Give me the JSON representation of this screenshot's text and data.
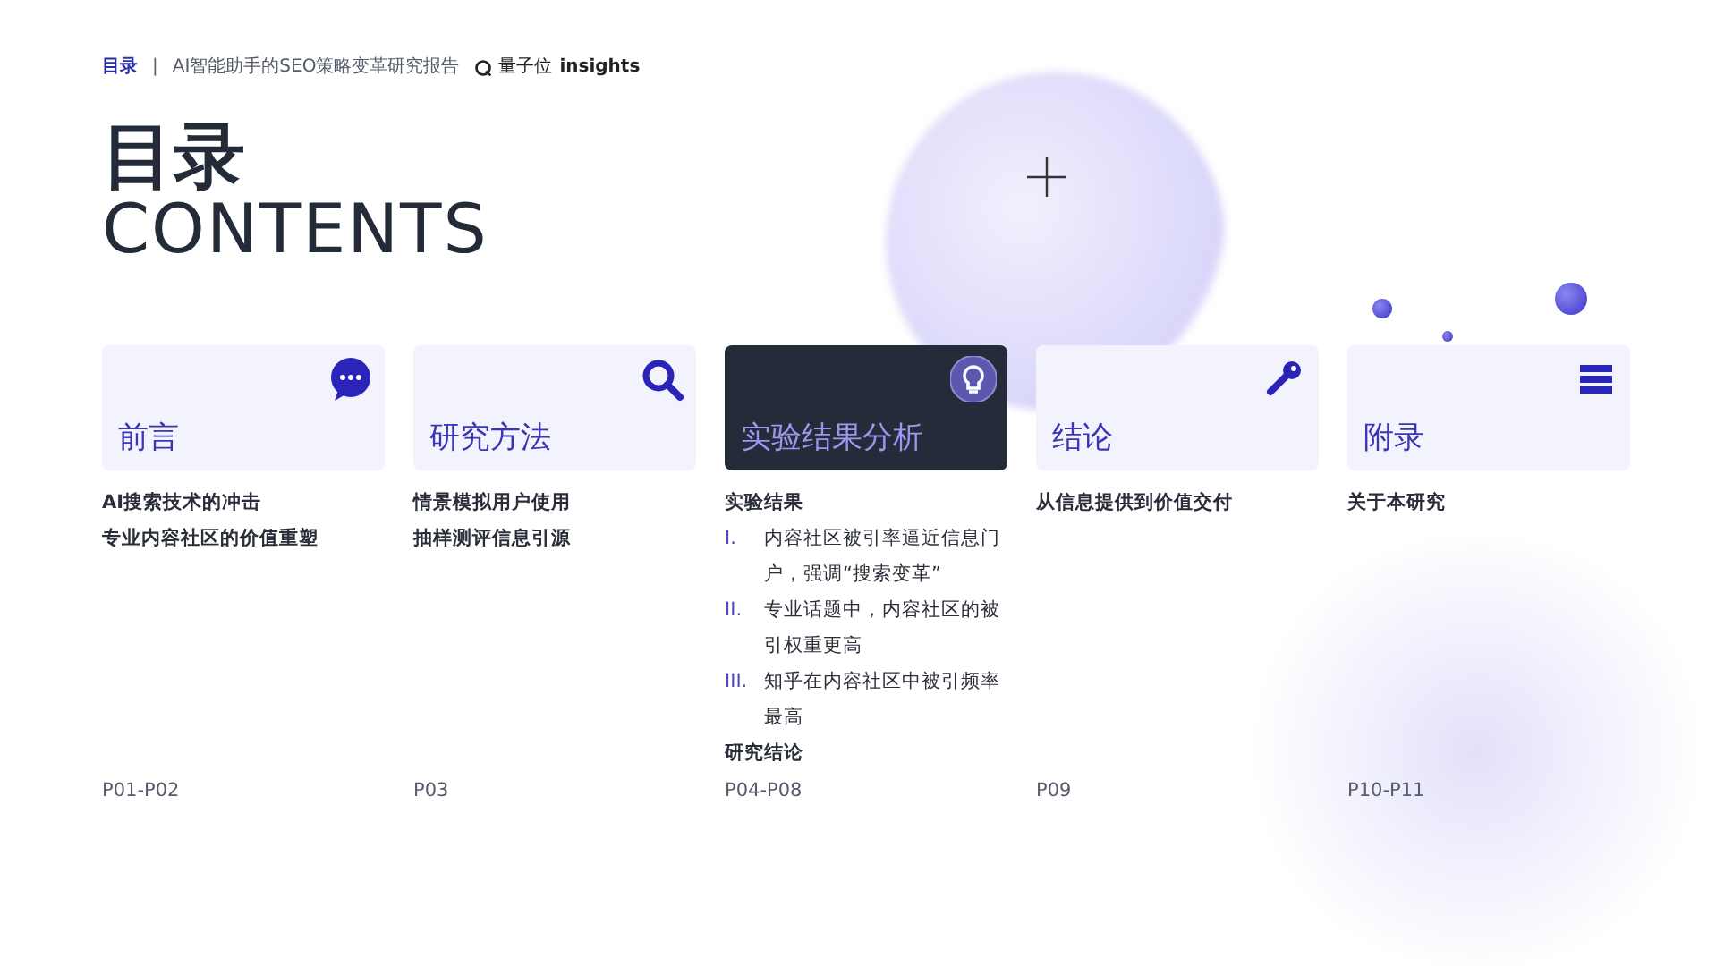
{
  "header": {
    "section": "目录",
    "separator": "|",
    "report_title": "AI智能助手的SEO策略变革研究报告",
    "logo_text": "量子位",
    "logo_suffix": "insights"
  },
  "title": {
    "main": "目录",
    "sub": "CONTENTS"
  },
  "sections": [
    {
      "title": "前言",
      "kind": "chat",
      "selected": false,
      "items": [
        {
          "kind": "heading",
          "text": "AI搜索技术的冲击"
        },
        {
          "kind": "heading",
          "text": "专业内容社区的价值重塑"
        }
      ],
      "pages": "P01-P02"
    },
    {
      "title": "研究方法",
      "kind": "search",
      "selected": false,
      "items": [
        {
          "kind": "heading",
          "text": "情景模拟用户使用"
        },
        {
          "kind": "heading",
          "text": "抽样测评信息引源"
        }
      ],
      "pages": "P03"
    },
    {
      "title": "实验结果分析",
      "kind": "bulb",
      "selected": true,
      "items": [
        {
          "kind": "heading",
          "text": "实验结果"
        },
        {
          "kind": "numbered",
          "marker": "I.",
          "text": "内容社区被引率逼近信息门户，强调“搜索变革”"
        },
        {
          "kind": "numbered",
          "marker": "II.",
          "text": "专业话题中，内容社区的被引权重更高"
        },
        {
          "kind": "numbered",
          "marker": "III.",
          "text": "知乎在内容社区中被引频率最高"
        },
        {
          "kind": "heading",
          "text": "研究结论"
        }
      ],
      "pages": "P04-P08"
    },
    {
      "title": "结论",
      "kind": "key",
      "selected": false,
      "items": [
        {
          "kind": "heading",
          "text": "从信息提供到价值交付"
        }
      ],
      "pages": "P09"
    },
    {
      "title": "附录",
      "kind": "stack",
      "selected": false,
      "items": [
        {
          "kind": "heading",
          "text": "关于本研究"
        }
      ],
      "pages": "P10-P11"
    }
  ]
}
